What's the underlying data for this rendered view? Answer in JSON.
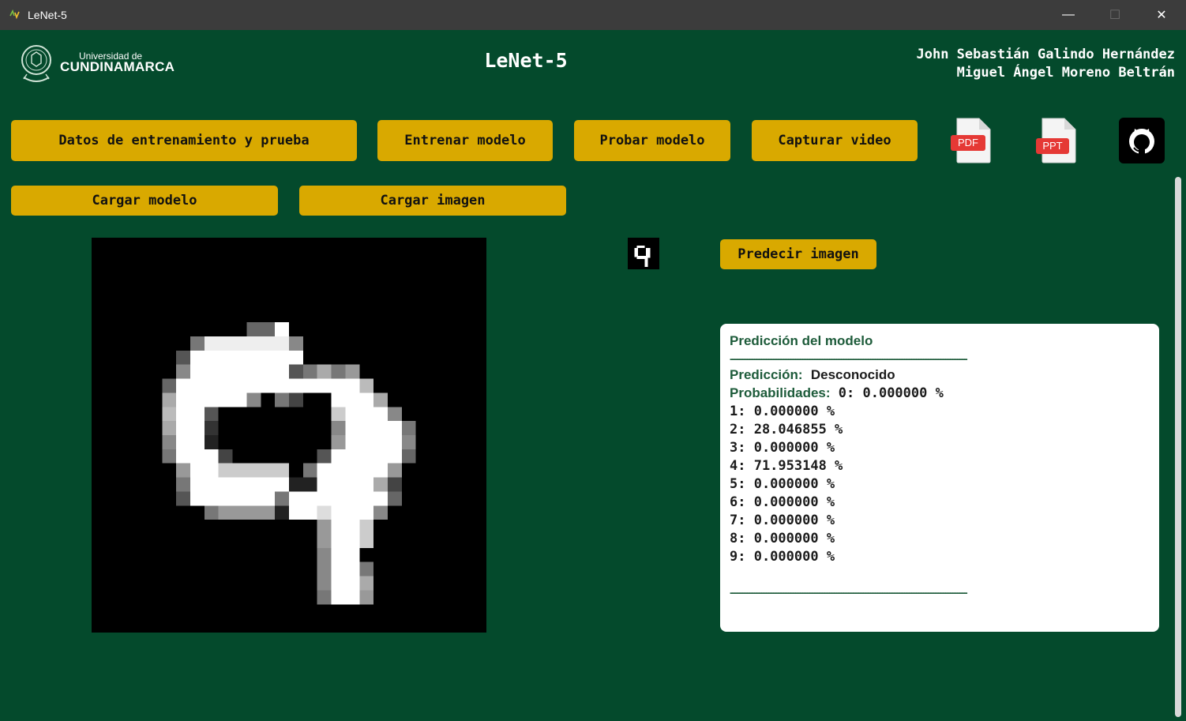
{
  "window": {
    "title": "LeNet-5",
    "controls": {
      "minimize": "—",
      "maximize": "☐",
      "close": "✕"
    },
    "icon": "python-icon"
  },
  "header": {
    "logo": {
      "line1": "Universidad de",
      "line2": "CUNDINAMARCA"
    },
    "title": "LeNet-5",
    "authors": [
      "John Sebastián Galindo Hernández",
      "Miguel Ángel Moreno Beltrán"
    ]
  },
  "toolbar": {
    "datos_label": "Datos de entrenamiento y prueba",
    "entrenar_label": "Entrenar modelo",
    "probar_label": "Probar modelo",
    "capturar_label": "Capturar video",
    "pdf_label": "PDF",
    "ppt_label": "PPT",
    "github_icon": "github-icon"
  },
  "secondary": {
    "cargar_modelo_label": "Cargar modelo",
    "cargar_imagen_label": "Cargar imagen",
    "predecir_label": "Predecir imagen"
  },
  "colors": {
    "background": "#044a2c",
    "button": "#d9a900",
    "label_green": "#1d5b3a"
  },
  "panel": {
    "title": "Predicción del modelo",
    "separator": "--------------------------------------------------------------------------------------------------",
    "prediction_label": "Predicción:",
    "prediction_value": "Desconocido",
    "probabilities_label": "Probabilidades:",
    "probabilities": [
      "0: 0.000000 %",
      "1: 0.000000 %",
      "2: 28.046855 %",
      "3: 0.000000 %",
      "4: 71.953148 %",
      "5: 0.000000 %",
      "6: 0.000000 %",
      "7: 0.000000 %",
      "8: 0.000000 %",
      "9: 0.000000 %"
    ]
  }
}
